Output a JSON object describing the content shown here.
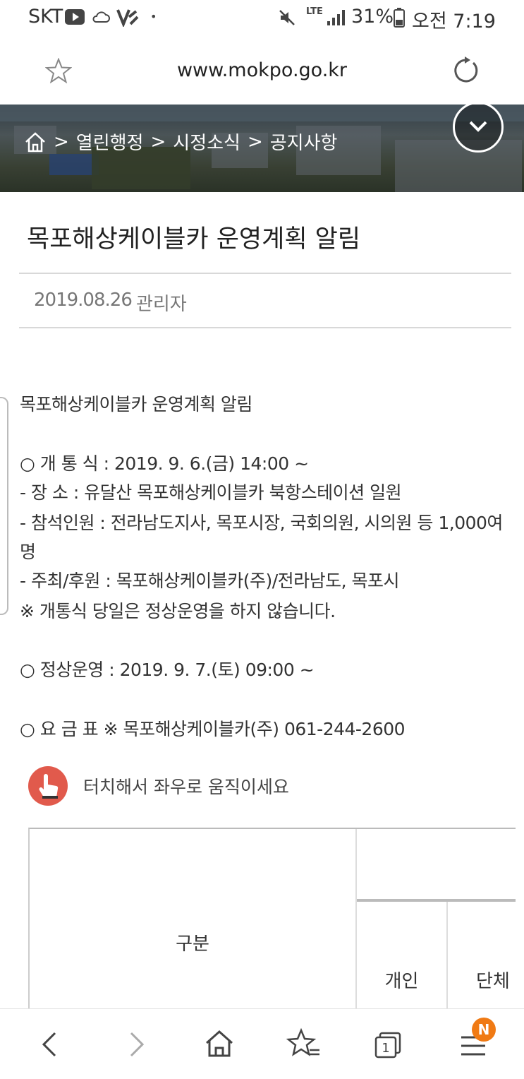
{
  "status_bar": {
    "carrier": "SKT",
    "network": "LTE",
    "battery": "31%",
    "time": "오전 7:19"
  },
  "browser": {
    "url": "www.mokpo.go.kr"
  },
  "breadcrumb": {
    "sep": ">",
    "items": [
      "열린행정",
      "시정소식",
      "공지사항"
    ]
  },
  "post": {
    "title": "목포해상케이블카 운영계획 알림",
    "date": "2019.08.26",
    "author": "관리자"
  },
  "body_lines": [
    "목포해상케이블카 운영계획 알림",
    "○ 개 통 식 : 2019. 9. 6.(금) 14:00 ~",
    "- 장 소 : 유달산 목포해상케이블카 북항스테이션 일원",
    "- 참석인원 : 전라남도지사, 목포시장, 국회의원, 시의원 등 1,000여",
    "명",
    "- 주최/후원 : 목포해상케이블카(주)/전라남도, 목포시",
    "※ 개통식 당일은 정상운영을 하지 않습니다.",
    "○ 정상운영 : 2019. 9. 7.(토) 09:00 ~",
    "○ 요 금 표 ※ 목포해상케이블카(주) 061-244-2600"
  ],
  "touch_hint": "터치해서 좌우로 움직이세요",
  "fare_table": {
    "headers": [
      "구분",
      "개인",
      "단체"
    ]
  },
  "bottom_nav": {
    "badge": "N",
    "tab_count": "1"
  }
}
